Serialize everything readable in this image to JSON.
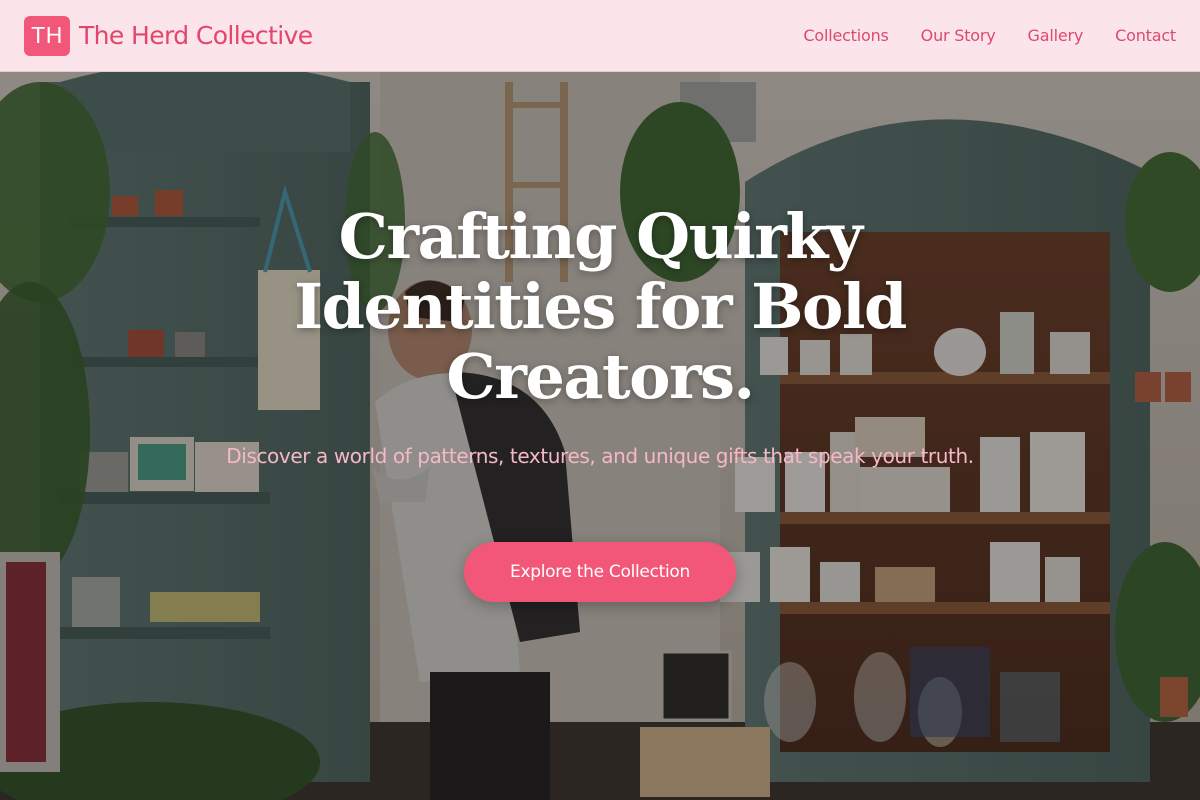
{
  "header": {
    "logo_text": "TH",
    "brand_name": "The Herd Collective",
    "nav": [
      "Collections",
      "Our Story",
      "Gallery",
      "Contact"
    ]
  },
  "hero": {
    "title": "Crafting Quirky Identities for Bold Creators.",
    "subtitle": "Discover a world of patterns, textures, and unique gifts that speak your truth.",
    "cta_label": "Explore the Collection",
    "background_image": "shop-interior-photo"
  },
  "colors": {
    "accent": "#f2577a",
    "header_bg": "#fbe4ea",
    "nav_text": "#dc4a6e",
    "subtitle_text": "#f6b8c6"
  }
}
